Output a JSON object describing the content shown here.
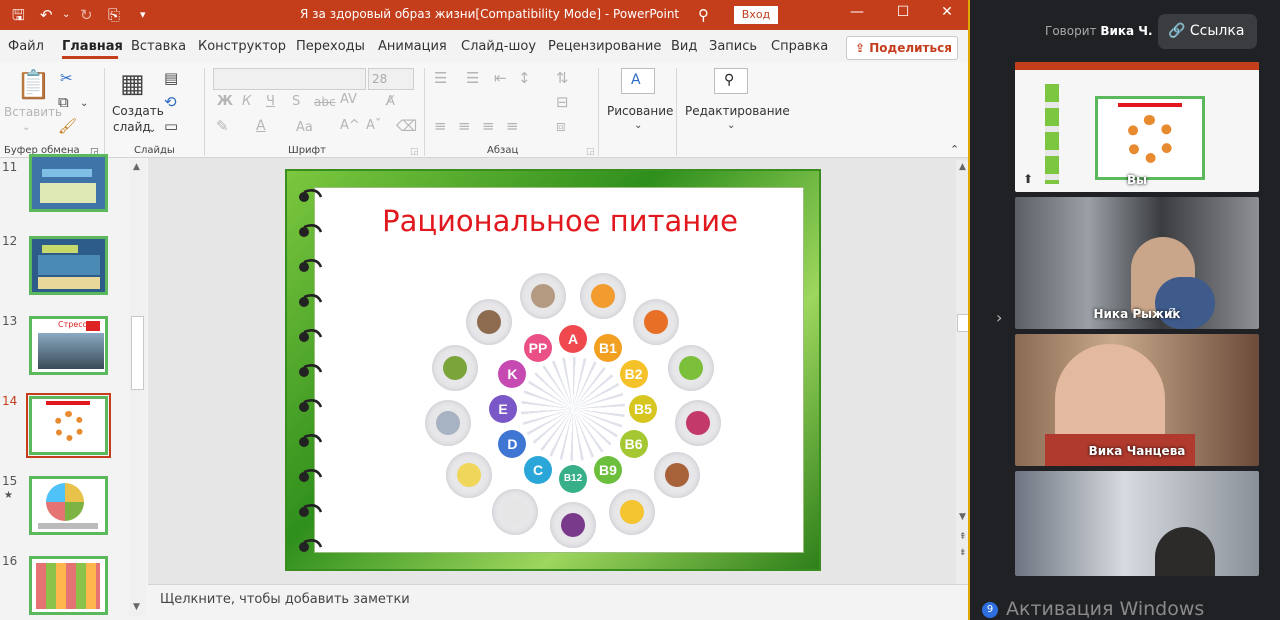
{
  "window": {
    "title": "Я за здоровый образ жизни[Compatibility Mode]  -  PowerPoint",
    "login_label": "Вход"
  },
  "menu": {
    "items": [
      "Файл",
      "Главная",
      "Вставка",
      "Конструктор",
      "Переходы",
      "Анимация",
      "Слайд-шоу",
      "Рецензирование",
      "Вид",
      "Запись",
      "Справка"
    ],
    "share_label": "Поделиться"
  },
  "ribbon": {
    "paste_label": "Вставить",
    "new_slide_label_1": "Создать",
    "new_slide_label_2": "слайд",
    "font_size": "28",
    "drawing_label": "Рисование",
    "editing_label": "Редактирование",
    "group_clipboard": "Буфер обмена",
    "group_slides": "Слайды",
    "group_font": "Шрифт",
    "group_paragraph": "Абзац",
    "font_buttons": [
      "Ж",
      "К",
      "Ч",
      "S"
    ]
  },
  "thumbnails": [
    {
      "num": "11",
      "theme": "blue"
    },
    {
      "num": "12",
      "theme": "darkblue"
    },
    {
      "num": "13",
      "theme": "photo",
      "caption": "Стресс"
    },
    {
      "num": "14",
      "theme": "current"
    },
    {
      "num": "15",
      "theme": "plate",
      "star": "★"
    },
    {
      "num": "16",
      "theme": "food"
    }
  ],
  "slide": {
    "title": "Рациональное питание",
    "vitamins": [
      {
        "label": "A",
        "color": "#f0484f"
      },
      {
        "label": "B1",
        "color": "#f2a021"
      },
      {
        "label": "B2",
        "color": "#f5c22a"
      },
      {
        "label": "B5",
        "color": "#d6c61f"
      },
      {
        "label": "B6",
        "color": "#a5c832"
      },
      {
        "label": "B9",
        "color": "#6cbf3c"
      },
      {
        "label": "B12",
        "color": "#37b08a"
      },
      {
        "label": "C",
        "color": "#2aa7d8"
      },
      {
        "label": "D",
        "color": "#3f76d4"
      },
      {
        "label": "E",
        "color": "#7b58c7"
      },
      {
        "label": "K",
        "color": "#c64ab2"
      },
      {
        "label": "PP",
        "color": "#ea4f86"
      }
    ]
  },
  "notes": {
    "placeholder": "Щелкните, чтобы добавить заметки"
  },
  "meeting": {
    "speaking_prefix": "Говорит",
    "speaker": "Вика Ч.",
    "link_label": "Ссылка",
    "participants": [
      {
        "name": "Вы"
      },
      {
        "name": "Ника Рыжик"
      },
      {
        "name": "Вика Чанцева"
      },
      {
        "name": ""
      }
    ],
    "participant_count": "9",
    "activation_text": "Активация Windows"
  },
  "colors": {
    "accent": "#c43e1c",
    "slide_green": "#5cb85c"
  }
}
